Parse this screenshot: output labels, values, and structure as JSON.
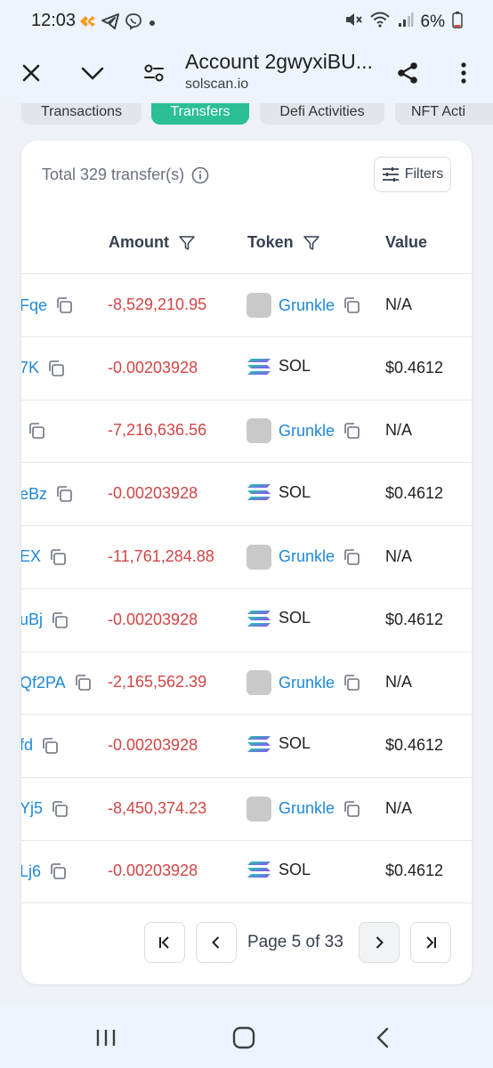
{
  "status_bar": {
    "time": "12:03",
    "battery": "6%",
    "icons": [
      "app-notification-icon",
      "telegram-icon",
      "viber-icon",
      "dot-icon",
      "mute-icon",
      "wifi-icon",
      "signal-icon",
      "battery-icon"
    ]
  },
  "toolbar": {
    "title": "Account 2gwyxiBU...",
    "url": "solscan.io"
  },
  "tabs": [
    {
      "label": "Transactions",
      "active": false
    },
    {
      "label": "Transfers",
      "active": true
    },
    {
      "label": "Defi Activities",
      "active": false
    },
    {
      "label": "NFT Acti",
      "active": false
    }
  ],
  "summary": {
    "total_label": "Total 329 transfer(s)",
    "filters_label": "Filters"
  },
  "table": {
    "headers": {
      "amount": "Amount",
      "token": "Token",
      "value": "Value"
    },
    "rows": [
      {
        "from": "Fqe",
        "amount": "-8,529,210.95",
        "token": "Grunkle",
        "token_kind": "grunkle",
        "value": "N/A"
      },
      {
        "from": "7K",
        "amount": "-0.00203928",
        "token": "SOL",
        "token_kind": "sol",
        "value": "$0.4612"
      },
      {
        "from": "",
        "amount": "-7,216,636.56",
        "token": "Grunkle",
        "token_kind": "grunkle",
        "value": "N/A"
      },
      {
        "from": "eBz",
        "amount": "-0.00203928",
        "token": "SOL",
        "token_kind": "sol",
        "value": "$0.4612"
      },
      {
        "from": "EX",
        "amount": "-11,761,284.88",
        "token": "Grunkle",
        "token_kind": "grunkle",
        "value": "N/A"
      },
      {
        "from": "uBj",
        "amount": "-0.00203928",
        "token": "SOL",
        "token_kind": "sol",
        "value": "$0.4612"
      },
      {
        "from": "Qf2PA",
        "amount": "-2,165,562.39",
        "token": "Grunkle",
        "token_kind": "grunkle",
        "value": "N/A"
      },
      {
        "from": "fd",
        "amount": "-0.00203928",
        "token": "SOL",
        "token_kind": "sol",
        "value": "$0.4612"
      },
      {
        "from": "Yj5",
        "amount": "-8,450,374.23",
        "token": "Grunkle",
        "token_kind": "grunkle",
        "value": "N/A"
      },
      {
        "from": "Lj6",
        "amount": "-0.00203928",
        "token": "SOL",
        "token_kind": "sol",
        "value": "$0.4612"
      }
    ]
  },
  "pagination": {
    "label": "Page 5 of 33"
  },
  "colors": {
    "accent_green": "#2bbf94",
    "link_blue": "#1e88d8",
    "negative_red": "#d24545"
  }
}
